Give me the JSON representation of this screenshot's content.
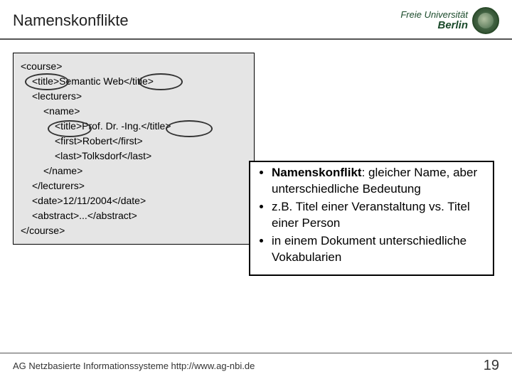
{
  "header": {
    "title": "Namenskonflikte",
    "logo_text": "Freie Universität",
    "logo_city": "Berlin"
  },
  "code": {
    "l1": "<course>",
    "l2a": "<title>",
    "l2b": "Semantic Web",
    "l2c": "</title>",
    "l3": "<lecturers>",
    "l4": "<name>",
    "l5a": "<title>",
    "l5b": "Prof. Dr. -Ing.",
    "l5c": "</title>",
    "l6": "<first>Robert</first>",
    "l7": "<last>Tolksdorf</last>",
    "l8": "</name>",
    "l9": "</lecturers>",
    "l10": "<date>12/11/2004</date>",
    "l11": "<abstract>...</abstract>",
    "l12": "</course>"
  },
  "bullets": {
    "b1_strong": "Namenskonflikt",
    "b1_rest": ": gleicher Name, aber unterschiedliche Bedeutung",
    "b2": "z.B. Titel einer Veranstaltung vs. Titel einer Person",
    "b3": "in einem Dokument unterschiedliche Vokabularien"
  },
  "footer": {
    "left": "AG Netzbasierte Informationssysteme http://www.ag-nbi.de",
    "page": "19"
  }
}
